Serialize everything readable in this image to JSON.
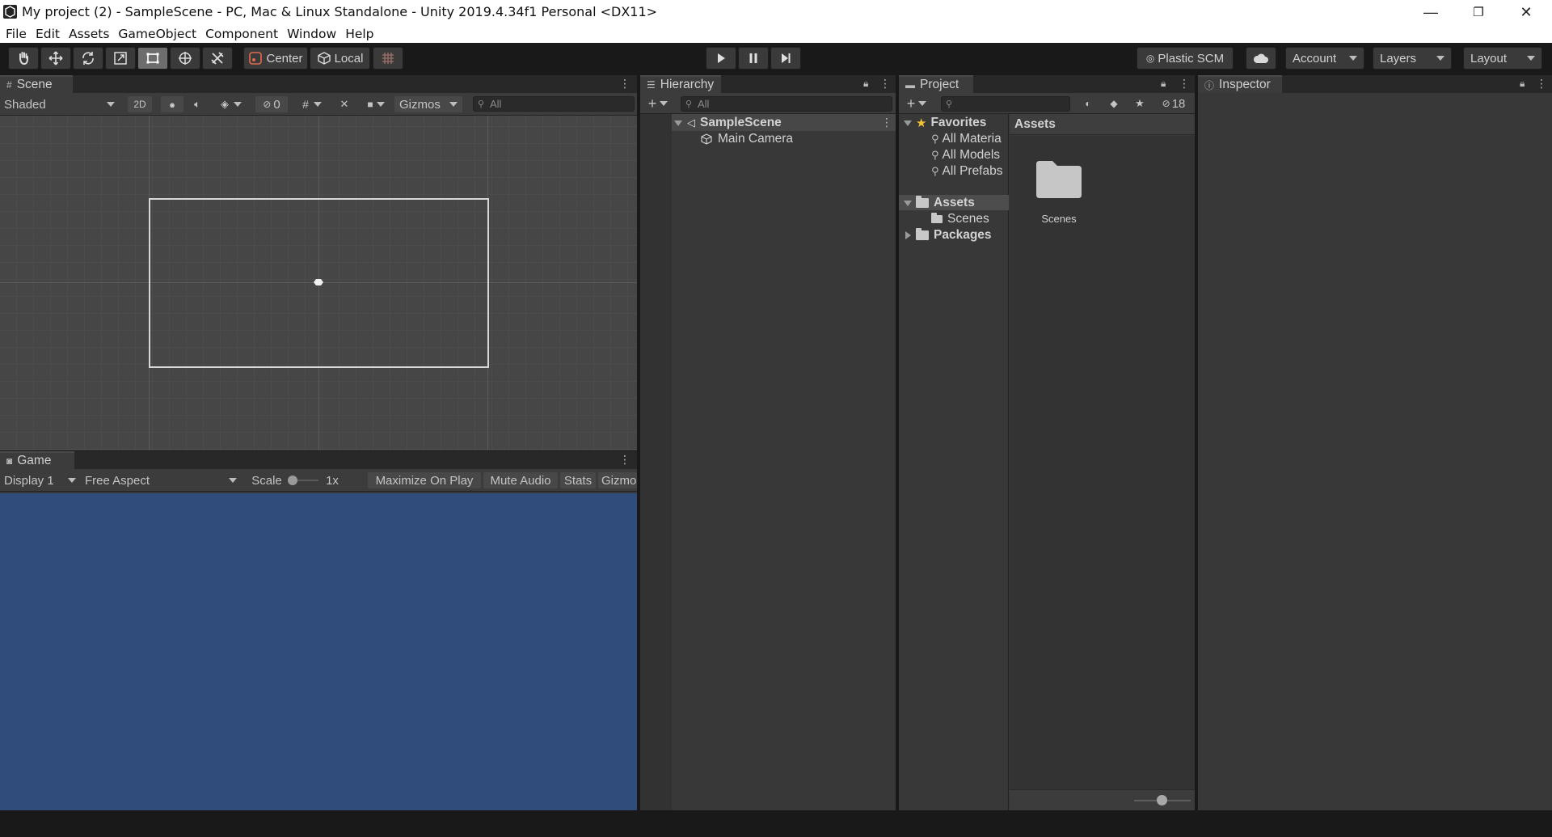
{
  "window": {
    "title": "My project (2) - SampleScene - PC, Mac & Linux Standalone - Unity 2019.4.34f1 Personal <DX11>",
    "minimize": "—",
    "maximize": "❐",
    "close": "✕"
  },
  "menu": [
    "File",
    "Edit",
    "Assets",
    "GameObject",
    "Component",
    "Window",
    "Help"
  ],
  "toolbar": {
    "pivot_label": "Center",
    "space_label": "Local",
    "plastic_label": "Plastic SCM",
    "account_label": "Account",
    "layers_label": "Layers",
    "layout_label": "Layout"
  },
  "scene": {
    "tab_label": "Scene",
    "draw_mode": "Shaded",
    "mode_2d": "2D",
    "hidden_count": "0",
    "gizmos_label": "Gizmos",
    "search_placeholder": "All"
  },
  "game": {
    "tab_label": "Game",
    "display": "Display 1",
    "aspect": "Free Aspect",
    "scale_label": "Scale",
    "scale_value": "1x",
    "maximize_label": "Maximize On Play",
    "mute_label": "Mute Audio",
    "stats_label": "Stats",
    "gizmos_label": "Gizmo",
    "background_color": "#304c7b"
  },
  "hierarchy": {
    "tab_label": "Hierarchy",
    "search_placeholder": "All",
    "scene_name": "SampleScene",
    "items": [
      "Main Camera"
    ]
  },
  "project": {
    "tab_label": "Project",
    "hidden_count": "18",
    "favorites_label": "Favorites",
    "favorites": [
      "All Materia",
      "All Models",
      "All Prefabs"
    ],
    "assets_label": "Assets",
    "asset_children": [
      "Scenes"
    ],
    "packages_label": "Packages",
    "breadcrumb": "Assets",
    "grid_items": [
      {
        "name": "Scenes",
        "icon": "folder-icon"
      }
    ]
  },
  "inspector": {
    "tab_label": "Inspector"
  }
}
